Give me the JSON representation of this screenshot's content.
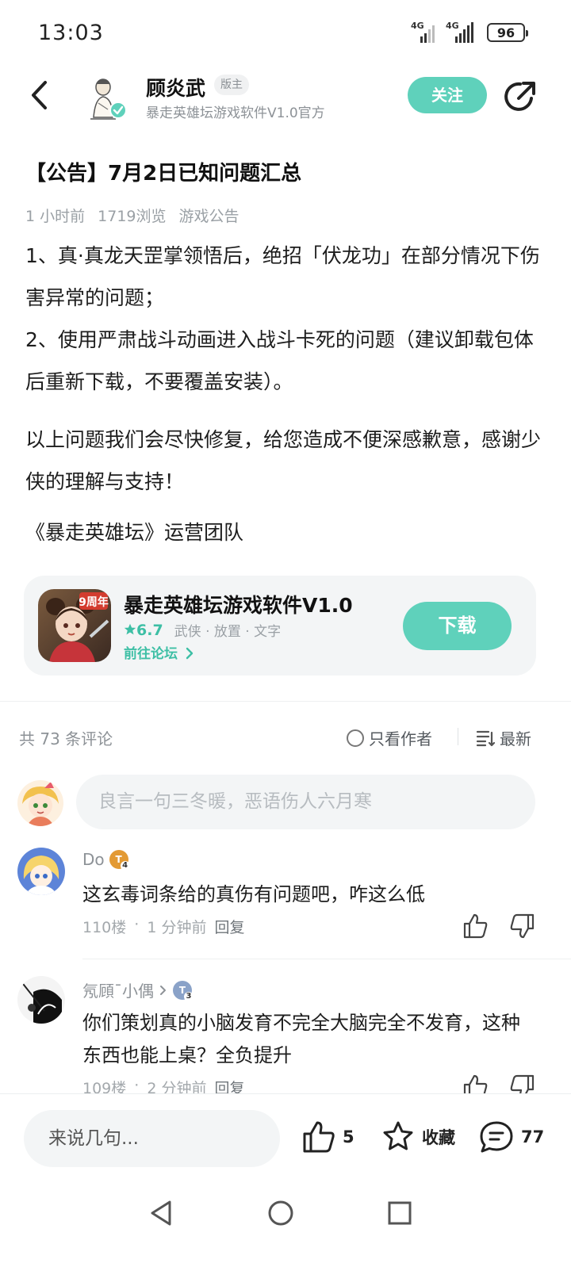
{
  "status_bar": {
    "time": "13:03",
    "network_1": "4G",
    "network_2": "4G",
    "battery": "96"
  },
  "header": {
    "author_name": "顾炎武",
    "author_badge": "版主",
    "author_subtitle": "暴走英雄坛游戏软件V1.0官方",
    "follow_label": "关注"
  },
  "post": {
    "title": "【公告】7月2日已知问题汇总",
    "meta": {
      "time": "1 小时前",
      "views": "1719浏览",
      "category": "游戏公告"
    },
    "paragraphs": [
      "1、真·真龙天罡掌领悟后，绝招「伏龙功」在部分情况下伤害异常的问题；",
      "2、使用严肃战斗动画进入战斗卡死的问题（建议卸载包体后重新下载，不要覆盖安装）。",
      "以上问题我们会尽快修复，给您造成不便深感歉意，感谢少侠的理解与支持！"
    ],
    "signature": "《暴走英雄坛》运营团队"
  },
  "game_card": {
    "name": "暴走英雄坛游戏软件V1.0",
    "score": "6.7",
    "tags": "武侠 · 放置 · 文字",
    "forum_link": "前往论坛",
    "download_label": "下载",
    "icon_badge": "9周年"
  },
  "comments_header": {
    "count": "共 73 条评论",
    "author_only": "只看作者",
    "sort": "最新"
  },
  "comment_input_placeholder": "良言一句三冬暖，恶语伤人六月寒",
  "comments": [
    {
      "user": "Do",
      "level": "4",
      "text": "这玄毒词条给的真伤有问题吧，咋这么低",
      "floor": "110楼",
      "time": "1 分钟前",
      "reply": "回复"
    },
    {
      "user": "氖頋ˉ小偶",
      "level": "3",
      "text": "你们策划真的小脑发育不完全大脑完全不发育，这种东西也能上桌？全负提升",
      "floor": "109楼",
      "time": "2 分钟前",
      "reply": "回复"
    }
  ],
  "bottom_bar": {
    "reply_placeholder": "来说几句...",
    "likes": "5",
    "favorite_label": "收藏",
    "comments": "77"
  },
  "colors": {
    "accent": "#5fd1bb",
    "accent_text": "#3dbfa5"
  }
}
